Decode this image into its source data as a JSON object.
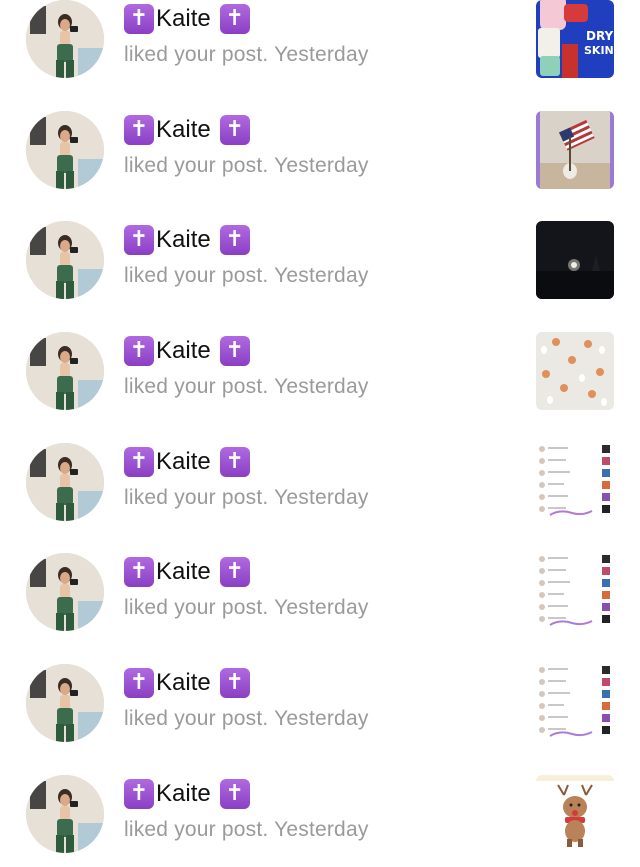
{
  "notifications": [
    {
      "badge_left": "✝",
      "name": "Kaite",
      "badge_right": "✝",
      "action": "liked your post.",
      "time": "Yesterday",
      "thumbnail": "skincare-products-photo"
    },
    {
      "badge_left": "✝",
      "name": "Kaite",
      "badge_right": "✝",
      "action": "liked your post.",
      "time": "Yesterday",
      "thumbnail": "american-flag-photo"
    },
    {
      "badge_left": "✝",
      "name": "Kaite",
      "badge_right": "✝",
      "action": "liked your post.",
      "time": "Yesterday",
      "thumbnail": "night-moon-photo"
    },
    {
      "badge_left": "✝",
      "name": "Kaite",
      "badge_right": "✝",
      "action": "liked your post.",
      "time": "Yesterday",
      "thumbnail": "pumpkin-ghost-pattern"
    },
    {
      "badge_left": "✝",
      "name": "Kaite",
      "badge_right": "✝",
      "action": "liked your post.",
      "time": "Yesterday",
      "thumbnail": "thank-you-screenshot"
    },
    {
      "badge_left": "✝",
      "name": "Kaite",
      "badge_right": "✝",
      "action": "liked your post.",
      "time": "Yesterday",
      "thumbnail": "thank-you-screenshot"
    },
    {
      "badge_left": "✝",
      "name": "Kaite",
      "badge_right": "✝",
      "action": "liked your post.",
      "time": "Yesterday",
      "thumbnail": "thank-you-screenshot"
    },
    {
      "badge_left": "✝",
      "name": "Kaite",
      "badge_right": "✝",
      "action": "liked your post.",
      "time": "Yesterday",
      "thumbnail": "reindeer-illustration"
    }
  ],
  "colors": {
    "badge": "#9b4fd1",
    "name_text": "#111111",
    "secondary_text": "#9a9a9a",
    "background": "#ffffff"
  }
}
